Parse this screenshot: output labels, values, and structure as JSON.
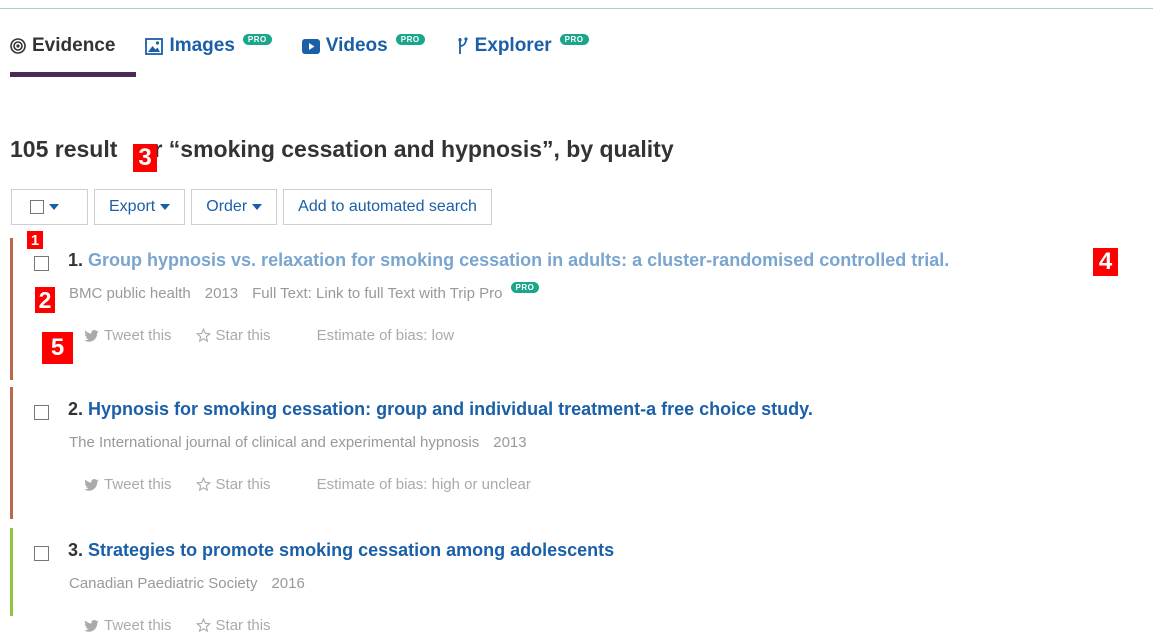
{
  "tabs": [
    {
      "label": "Evidence",
      "icon": "target-icon",
      "pro": false
    },
    {
      "label": "Images",
      "icon": "image-icon",
      "pro": true
    },
    {
      "label": "Videos",
      "icon": "video-icon",
      "pro": true
    },
    {
      "label": "Explorer",
      "icon": "explorer-icon",
      "pro": true
    }
  ],
  "pro_badge": "PRO",
  "heading": {
    "part1": "105 result",
    "part2": "or “smoking cessation and hypnosis”, by quality"
  },
  "toolbar": {
    "export_label": "Export",
    "order_label": "Order",
    "automated_label": "Add to automated search"
  },
  "results": [
    {
      "number": "1.",
      "title": "Group hypnosis vs. relaxation for smoking cessation in adults: a cluster-randomised controlled trial.",
      "source": "BMC public health",
      "year": "2013",
      "fulltext": "Full Text: Link to full Text with Trip Pro",
      "tweet": "Tweet this",
      "star": "Star this",
      "bias": "Estimate of bias: low",
      "bar_color": "#b9684a"
    },
    {
      "number": "2.",
      "title": "Hypnosis for smoking cessation: group and individual treatment-a free choice study.",
      "source": "The International journal of clinical and experimental hypnosis",
      "year": "2013",
      "tweet": "Tweet this",
      "star": "Star this",
      "bias": "Estimate of bias: high or unclear",
      "bar_color": "#b9684a"
    },
    {
      "number": "3.",
      "title": "Strategies to promote smoking cessation among adolescents",
      "source": "Canadian Paediatric Society",
      "year": "2016",
      "tweet": "Tweet this",
      "star": "Star this",
      "bar_color": "#8cc63f"
    }
  ],
  "markers": [
    "1",
    "2",
    "3",
    "4",
    "5"
  ],
  "colors": {
    "link": "#1a5fa8",
    "visited_link": "#7aa5cf",
    "tab_underline": "#4b2a57",
    "pro_badge": "#1aa68a",
    "marker": "#ff0000"
  }
}
